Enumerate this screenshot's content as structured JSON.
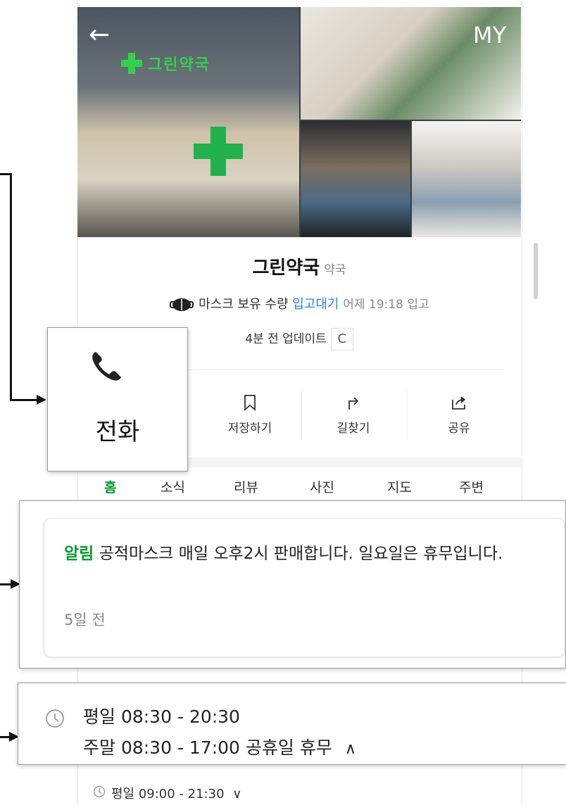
{
  "header": {
    "back_glyph": "←",
    "my_label": "MY"
  },
  "photos": {
    "sign_text": "그린약국",
    "sign_accent": "약"
  },
  "place": {
    "name": "그린약국",
    "category": "약국",
    "mask_prefix": "마스크 보유 수량",
    "mask_status": "입고대기",
    "mask_time": "어제 19:18 입고",
    "update_text": "4분 전 업데이트",
    "refresh_glyph": "C"
  },
  "actions": [
    {
      "label": "저장하기",
      "icon": "bookmark-icon"
    },
    {
      "label": "길찾기",
      "icon": "directions-icon"
    },
    {
      "label": "공유",
      "icon": "share-icon"
    }
  ],
  "tabs": [
    "홈",
    "소식",
    "리뷰",
    "사진",
    "지도",
    "주변"
  ],
  "callout_call": {
    "label": "전화",
    "icon": "phone-icon"
  },
  "notice": {
    "tag": "알림",
    "text": "공적마스크 매일 오후2시 판매합니다. 일요일은 휴무입니다.",
    "time": "5일 전"
  },
  "hours_callout": {
    "line1": "평일 08:30 - 20:30",
    "line2": "주말 08:30 - 17:00 공휴일 휴무",
    "toggle": "∧"
  },
  "hours_below": {
    "text": "평일 09:00 - 21:30",
    "toggle": "∨"
  },
  "colors": {
    "accent_green": "#0c9b32",
    "mask_blue": "#2f80ed"
  }
}
